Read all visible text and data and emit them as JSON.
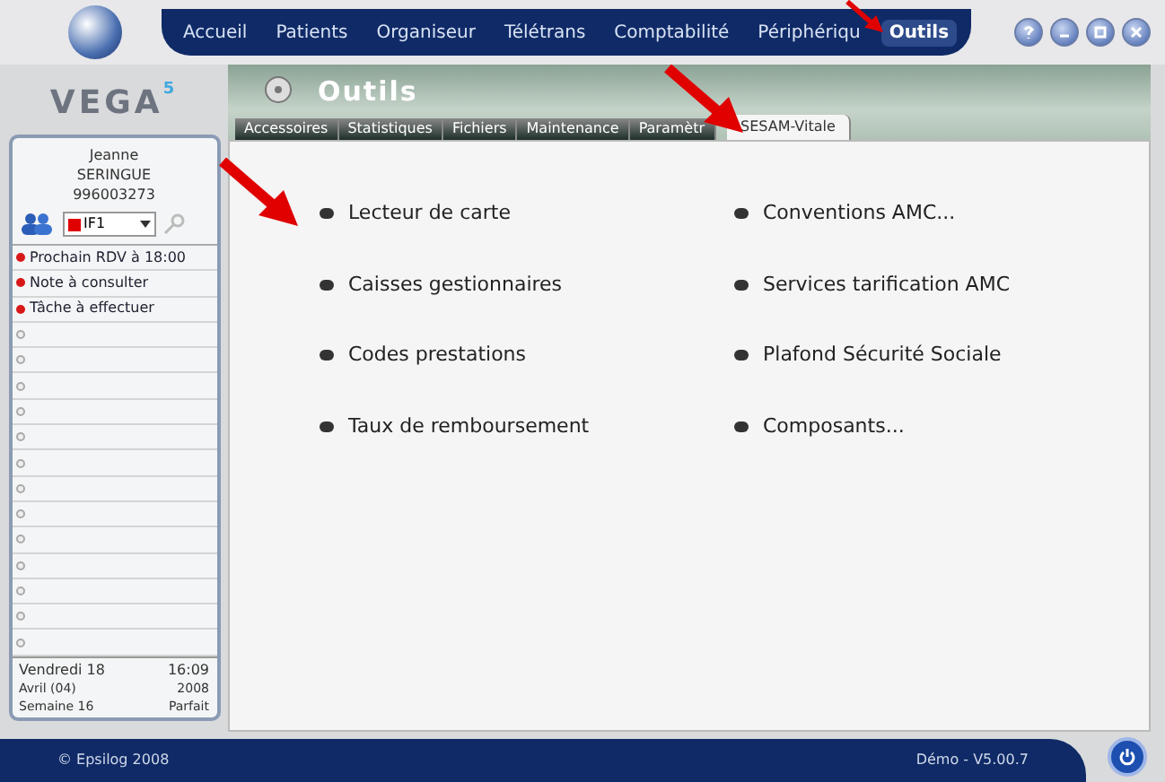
{
  "menu": [
    {
      "label": "Accueil",
      "selected": false
    },
    {
      "label": "Patients",
      "selected": false
    },
    {
      "label": "Organiseur",
      "selected": false
    },
    {
      "label": "Télétrans",
      "selected": false
    },
    {
      "label": "Comptabilité",
      "selected": false
    },
    {
      "label": "Périphériqu",
      "selected": false
    },
    {
      "label": "Outils",
      "selected": true
    }
  ],
  "logo": {
    "name": "VEGA",
    "version": "5"
  },
  "patient": {
    "first_name": "Jeanne",
    "last_name": "SERINGUE",
    "number": "996003273",
    "user": "IF1"
  },
  "reminders": [
    {
      "text": "Prochain RDV à 18:00",
      "active": true
    },
    {
      "text": "Note à consulter",
      "active": true
    },
    {
      "text": "Tâche à effectuer",
      "active": true
    },
    {
      "active": false
    },
    {
      "active": false
    },
    {
      "active": false
    },
    {
      "active": false
    },
    {
      "active": false
    },
    {
      "active": false
    },
    {
      "active": false
    },
    {
      "active": false
    },
    {
      "active": false
    },
    {
      "active": false
    },
    {
      "active": false
    },
    {
      "active": false
    },
    {
      "active": false
    }
  ],
  "date": {
    "day": "Vendredi 18",
    "time": "16:09",
    "month": "Avril (04)",
    "year": "2008",
    "week": "Semaine 16",
    "status": "Parfait"
  },
  "section_title": "Outils",
  "tabs": [
    {
      "label": "Accessoires",
      "selected": false
    },
    {
      "label": "Statistiques",
      "selected": false
    },
    {
      "label": "Fichiers",
      "selected": false
    },
    {
      "label": "Maintenance",
      "selected": false
    },
    {
      "label": "Paramètr",
      "selected": false
    },
    {
      "label": "SESAM-Vitale",
      "selected": true
    }
  ],
  "options": [
    {
      "label": "Lecteur de carte"
    },
    {
      "label": "Conventions AMC..."
    },
    {
      "label": "Caisses gestionnaires"
    },
    {
      "label": "Services tarification AMC"
    },
    {
      "label": "Codes prestations"
    },
    {
      "label": "Plafond Sécurité Sociale"
    },
    {
      "label": "Taux de remboursement"
    },
    {
      "label": "Composants..."
    }
  ],
  "footer": {
    "copyright": "© Epsilog 2008",
    "version": "Démo - V5.00.7"
  }
}
